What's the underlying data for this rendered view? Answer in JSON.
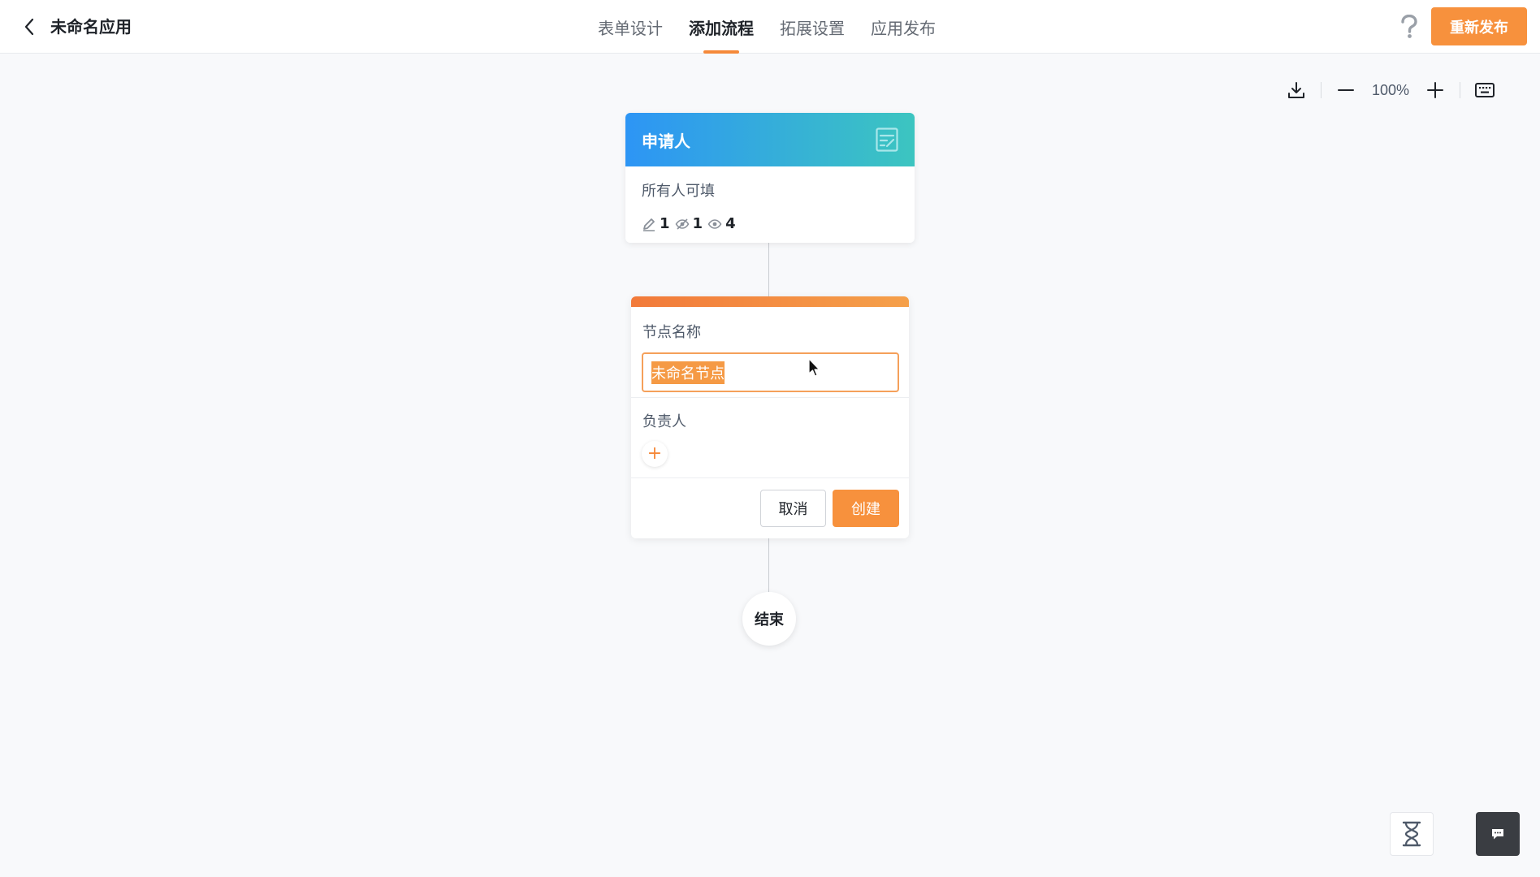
{
  "header": {
    "app_title": "未命名应用",
    "tabs": [
      {
        "label": "表单设计",
        "active": false
      },
      {
        "label": "添加流程",
        "active": true
      },
      {
        "label": "拓展设置",
        "active": false
      },
      {
        "label": "应用发布",
        "active": false
      }
    ],
    "republish_label": "重新发布",
    "accent_color": "#f7913d"
  },
  "toolbar": {
    "zoom": "100%"
  },
  "flow": {
    "applicant": {
      "title": "申请人",
      "subtitle": "所有人可填",
      "perm_edit": "1",
      "perm_hidden": "1",
      "perm_view": "4"
    },
    "node_form": {
      "name_label": "节点名称",
      "name_value": "未命名节点",
      "owner_label": "负责人",
      "add_icon": "+",
      "cancel_label": "取消",
      "create_label": "创建"
    },
    "end_label": "结束"
  }
}
